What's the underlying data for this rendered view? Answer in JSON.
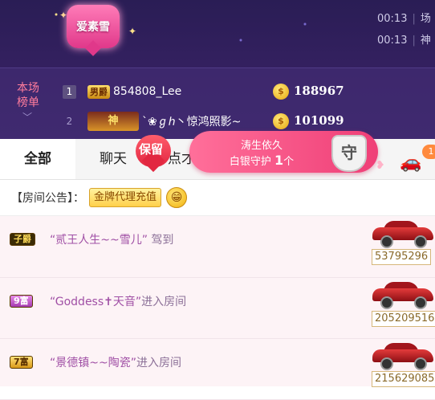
{
  "header": {
    "room_badge": "爱素雪",
    "right_rows": [
      {
        "time": "00:13",
        "text": "场"
      },
      {
        "time": "00:13",
        "text": "神"
      }
    ]
  },
  "rank": {
    "label_line1": "本场",
    "label_line2": "榜单",
    "rows": [
      {
        "pos": "1",
        "level": "男爵",
        "name": "854808_Lee",
        "score": "188967"
      },
      {
        "pos": "2",
        "level": "神",
        "name": "`❀ℊℎ丶惊鸿照影~",
        "score": "101099"
      }
    ]
  },
  "tabs": {
    "all": "全部",
    "chat": "聊天",
    "song": "点才"
  },
  "keep_badge": "保留",
  "guard": {
    "name": "涛生依久",
    "line2_prefix": "白银守护",
    "count": "1",
    "unit": "个",
    "shield_label": "守"
  },
  "car_badge_count": "1",
  "notice": {
    "label": "【房间公告】：",
    "agent_button": "金牌代理充值",
    "emoji": "😁"
  },
  "feed": [
    {
      "tag": "子爵",
      "name": "“贰王人生~~雪儿”",
      "action": " 驾到",
      "id": "53795296"
    },
    {
      "tag": "9富",
      "name": "“Goddess✝天音”",
      "action": "进入房间",
      "id": "205209516"
    },
    {
      "tag": "7富",
      "name": "“景德镇~~陶瓷”",
      "action": "进入房间",
      "id": "215629085"
    }
  ],
  "colors": {
    "header_bg": "#2a1d55",
    "accent_pink": "#ef3f77",
    "gold": "#e8a60c"
  }
}
